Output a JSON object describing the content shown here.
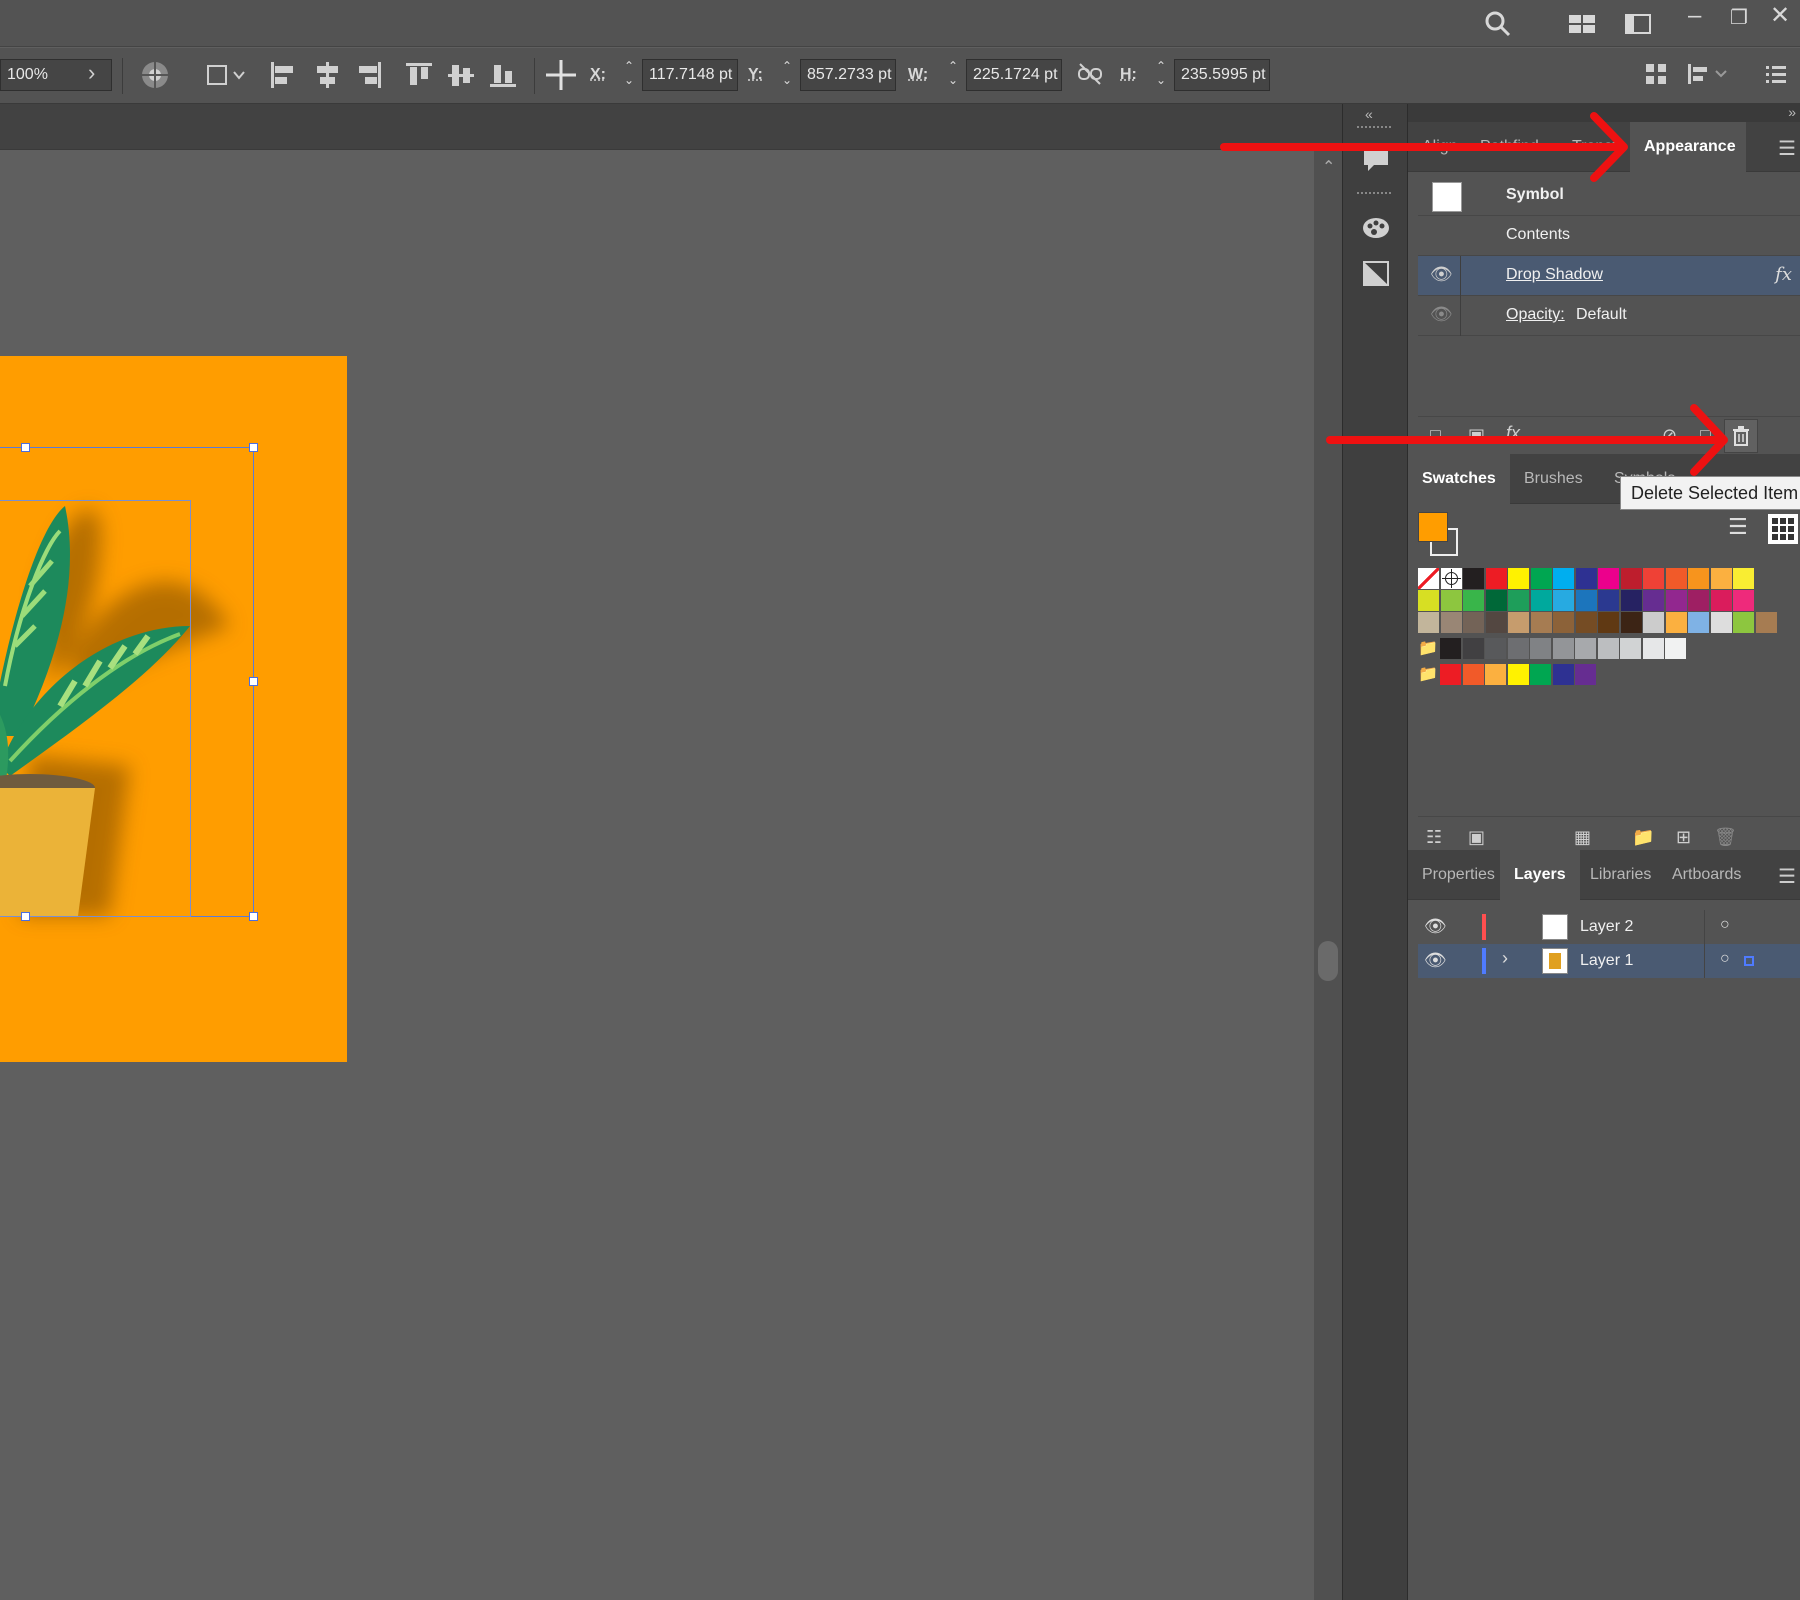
{
  "controlbar": {
    "zoom": "100%",
    "x_label": "X:",
    "x_value": "117.7148 pt",
    "y_label": "Y:",
    "y_value": "857.2733 pt",
    "w_label": "W:",
    "w_value": "225.1724 pt",
    "h_label": "H:",
    "h_value": "235.5995 pt"
  },
  "appearance_panel": {
    "tabs": [
      "Align",
      "Pathfind",
      "Transfo",
      "Appearance"
    ],
    "active_tab": "Appearance",
    "rows": [
      {
        "label": "Symbol"
      },
      {
        "label": "Contents"
      },
      {
        "label": "Drop Shadow",
        "fx": "fx"
      },
      {
        "label": "Opacity:",
        "value": "Default"
      }
    ]
  },
  "swatches_panel": {
    "tabs": [
      "Swatches",
      "Brushes",
      "Symbols"
    ],
    "tooltip": "Delete Selected Item",
    "fill_color": "#ff9d00",
    "rows": [
      [
        "#ffffff",
        "#ffffff",
        "#231f20",
        "#ed1c24",
        "#fff200",
        "#00a651",
        "#00aeef",
        "#2e3192",
        "#ec008c",
        "#be1e2d",
        "#ef4136",
        "#f15a29",
        "#f7941d",
        "#fbb040",
        "#f9ed32"
      ],
      [
        "#d7df23",
        "#8dc63f",
        "#39b54a",
        "#006838",
        "#1e9e5a",
        "#00a99d",
        "#27aae1",
        "#1c75bc",
        "#2b3990",
        "#262262",
        "#662d91",
        "#92278f",
        "#9e1f63",
        "#da1c5c",
        "#ee2a7b"
      ],
      [
        "#c2b59b",
        "#998675",
        "#736357",
        "#534741",
        "#c69c6d",
        "#a67c52",
        "#8c6239",
        "#754c24",
        "#603913",
        "#3c2415",
        "#cccccc",
        "#fbb040",
        "#7fb2e5",
        "#dddddd",
        "#8dc63f",
        "#a67c52"
      ],
      [
        "#231f20",
        "#414042",
        "#58595b",
        "#6d6e71",
        "#808285",
        "#939598",
        "#a7a9ac",
        "#bcbec0",
        "#d1d3d4",
        "#e6e7e8",
        "#f1f2f2"
      ],
      [
        "#ed1c24",
        "#f15a29",
        "#fbb040",
        "#fff200",
        "#00a651",
        "#2e3192",
        "#662d91"
      ]
    ]
  },
  "layers_panel": {
    "tabs": [
      "Properties",
      "Layers",
      "Libraries",
      "Artboards"
    ],
    "active_tab": "Layers",
    "layers": [
      {
        "name": "Layer 2",
        "color": "#ff4f4f"
      },
      {
        "name": "Layer 1",
        "color": "#4f7bff"
      }
    ]
  },
  "annotations": {
    "arrow_color": "#ee1111"
  }
}
